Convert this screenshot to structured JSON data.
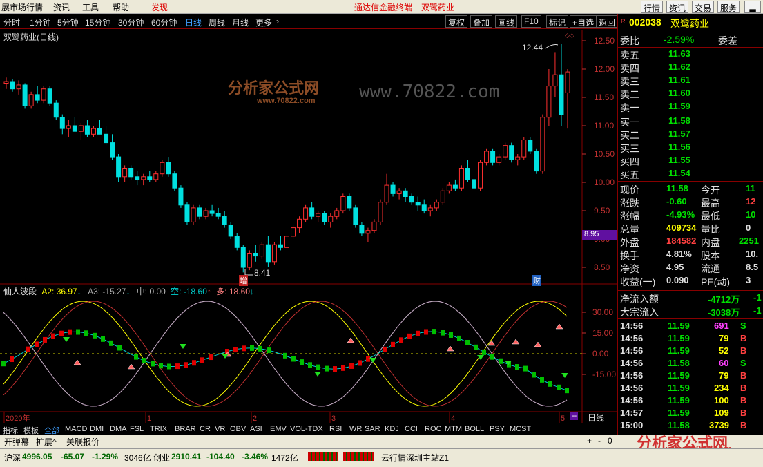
{
  "menu": {
    "items": [
      "展市场行情",
      "资讯",
      "工具",
      "帮助",
      "发现"
    ],
    "promo": [
      "通达信金融终端",
      "双鹭药业"
    ],
    "right_buttons": [
      "行情",
      "资讯",
      "交易",
      "服务"
    ]
  },
  "toolbar": {
    "periods": [
      "分时",
      "1分钟",
      "5分钟",
      "15分钟",
      "30分钟",
      "60分钟",
      "日线",
      "周线",
      "月线",
      "更多"
    ],
    "active_period": "日线",
    "actions": [
      "复权",
      "叠加",
      "画线",
      "F10",
      "标记",
      "+自选",
      "返回"
    ]
  },
  "chart_title": "双鹭药业(日线)",
  "watermark": {
    "main": "www.70822.com",
    "logo": "分析家公式网",
    "logo_sub": "www.70822.com"
  },
  "price_axis": {
    "labels": [
      "12.50",
      "12.00",
      "11.50",
      "11.00",
      "10.50",
      "10.00",
      "9.50",
      "9.00",
      "8.50"
    ],
    "highlight": "8.95"
  },
  "annotations": {
    "high": "12.44",
    "low": "8.41",
    "tag_zeng": "增",
    "tag_cai": "财"
  },
  "indicator": {
    "name": "仙人波段",
    "a2": "A2: 36.97",
    "a3": "A3: -15.27",
    "mid": "中: 0.00",
    "kong": "空: -18.60",
    "duo": "多: 18.60",
    "axis": [
      "30.00",
      "15.00",
      "0.00",
      "-15.00"
    ]
  },
  "time_axis": {
    "labels": [
      "2020年",
      "1",
      "2",
      "3",
      "4",
      "5"
    ],
    "period_label": "日线"
  },
  "tabs": [
    "指标",
    "模板",
    "全部",
    "MACD",
    "DMI",
    "DMA",
    "FSL",
    "TRIX",
    "BRAR",
    "CR",
    "VR",
    "OBV",
    "ASI",
    "EMV",
    "VOL-TDX",
    "RSI",
    "WR",
    "SAR",
    "KDJ",
    "CCI",
    "ROC",
    "MTM",
    "BOLL",
    "PSY",
    "MCST"
  ],
  "bottom_buttons": [
    "开弹幕",
    "扩展^",
    "关联报价"
  ],
  "quote": {
    "code": "002038",
    "name": "双鹭药业",
    "weibi_label": "委比",
    "weibi": "-2.59%",
    "weicha_label": "委差",
    "asks": [
      {
        "label": "卖五",
        "price": "11.63"
      },
      {
        "label": "卖四",
        "price": "11.62"
      },
      {
        "label": "卖三",
        "price": "11.61"
      },
      {
        "label": "卖二",
        "price": "11.60"
      },
      {
        "label": "卖一",
        "price": "11.59"
      }
    ],
    "bids": [
      {
        "label": "买一",
        "price": "11.58"
      },
      {
        "label": "买二",
        "price": "11.57"
      },
      {
        "label": "买三",
        "price": "11.56"
      },
      {
        "label": "买四",
        "price": "11.55"
      },
      {
        "label": "买五",
        "price": "11.54"
      }
    ],
    "stats": [
      {
        "l1": "现价",
        "v1": "11.58",
        "l2": "今开",
        "v2": "11"
      },
      {
        "l1": "涨跌",
        "v1": "-0.60",
        "l2": "最高",
        "v2": "12"
      },
      {
        "l1": "涨幅",
        "v1": "-4.93%",
        "l2": "最低",
        "v2": "10"
      },
      {
        "l1": "总量",
        "v1": "409734",
        "l2": "量比",
        "v2": "0"
      },
      {
        "l1": "外盘",
        "v1": "184582",
        "l2": "内盘",
        "v2": "2251"
      },
      {
        "l1": "换手",
        "v1": "4.81%",
        "l2": "股本",
        "v2": "10."
      },
      {
        "l1": "净资",
        "v1": "4.95",
        "l2": "流通",
        "v2": "8.5"
      },
      {
        "l1": "收益(一)",
        "v1": "0.090",
        "l2": "PE(动)",
        "v2": "3"
      }
    ],
    "flows": [
      {
        "label": "净流入额",
        "value": "-4712万",
        "extra": "-1"
      },
      {
        "label": "大宗流入",
        "value": "-3038万",
        "extra": "-1"
      }
    ],
    "ticks": [
      {
        "t": "14:56",
        "p": "11.59",
        "v": "691",
        "s": "S"
      },
      {
        "t": "14:56",
        "p": "11.59",
        "v": "79",
        "s": "B"
      },
      {
        "t": "14:56",
        "p": "11.59",
        "v": "52",
        "s": "B"
      },
      {
        "t": "14:56",
        "p": "11.58",
        "v": "60",
        "s": "S"
      },
      {
        "t": "14:56",
        "p": "11.59",
        "v": "79",
        "s": "B"
      },
      {
        "t": "14:56",
        "p": "11.59",
        "v": "234",
        "s": "B"
      },
      {
        "t": "14:56",
        "p": "11.59",
        "v": "100",
        "s": "B"
      },
      {
        "t": "14:57",
        "p": "11.59",
        "v": "109",
        "s": "B"
      },
      {
        "t": "15:00",
        "p": "11.58",
        "v": "3739",
        "s": "B"
      }
    ]
  },
  "status": {
    "sh_label": "沪深",
    "sh_value": "4996.05",
    "sh_change": "-65.07",
    "sh_pct": "-1.29%",
    "sh_amount": "3046亿",
    "cy_label": "创业",
    "cy_value": "2910.41",
    "cy_change": "-104.40",
    "cy_pct": "-3.46%",
    "cy_amount": "1472亿",
    "server": "云行情深圳主站Z1"
  },
  "candles": [
    [
      11.75,
      11.85,
      11.65,
      11.78
    ],
    [
      11.78,
      11.82,
      11.6,
      11.65
    ],
    [
      11.65,
      11.8,
      11.55,
      11.72
    ],
    [
      11.72,
      11.75,
      11.3,
      11.35
    ],
    [
      11.35,
      11.6,
      11.3,
      11.55
    ],
    [
      11.55,
      11.7,
      11.4,
      11.45
    ],
    [
      11.45,
      11.7,
      11.4,
      11.65
    ],
    [
      11.65,
      11.7,
      11.35,
      11.4
    ],
    [
      11.4,
      11.45,
      11.1,
      11.15
    ],
    [
      11.15,
      11.2,
      10.85,
      10.95
    ],
    [
      10.95,
      11.1,
      10.8,
      11.0
    ],
    [
      11.0,
      11.15,
      10.9,
      10.9
    ],
    [
      10.9,
      11.05,
      10.75,
      11.0
    ],
    [
      11.0,
      11.1,
      10.8,
      10.85
    ],
    [
      10.85,
      11.0,
      10.8,
      10.95
    ],
    [
      10.95,
      11.1,
      10.85,
      10.85
    ],
    [
      10.85,
      11.0,
      10.65,
      10.7
    ],
    [
      10.7,
      10.85,
      10.4,
      10.45
    ],
    [
      10.45,
      10.5,
      10.0,
      10.1
    ],
    [
      10.1,
      10.3,
      10.0,
      10.25
    ],
    [
      10.25,
      10.3,
      10.05,
      10.1
    ],
    [
      10.1,
      10.2,
      9.95,
      10.05
    ],
    [
      10.05,
      10.15,
      9.95,
      10.1
    ],
    [
      10.1,
      10.2,
      10.0,
      10.05
    ],
    [
      10.05,
      10.2,
      10.0,
      10.15
    ],
    [
      10.15,
      10.4,
      10.1,
      10.35
    ],
    [
      10.35,
      10.45,
      10.1,
      10.15
    ],
    [
      10.15,
      10.2,
      9.85,
      9.9
    ],
    [
      9.9,
      9.95,
      9.55,
      9.6
    ],
    [
      9.6,
      9.65,
      9.25,
      9.3
    ],
    [
      9.3,
      9.6,
      9.25,
      9.55
    ],
    [
      9.55,
      9.6,
      9.35,
      9.4
    ],
    [
      9.4,
      9.55,
      9.35,
      9.5
    ],
    [
      9.5,
      9.6,
      9.4,
      9.45
    ],
    [
      9.45,
      9.55,
      9.35,
      9.4
    ],
    [
      9.4,
      9.5,
      9.2,
      9.25
    ],
    [
      9.25,
      9.3,
      9.0,
      9.05
    ],
    [
      9.05,
      9.1,
      8.8,
      8.85
    ],
    [
      8.85,
      8.9,
      8.41,
      8.5
    ],
    [
      8.5,
      8.8,
      8.45,
      8.75
    ],
    [
      8.75,
      8.9,
      8.6,
      8.7
    ],
    [
      8.7,
      8.95,
      8.65,
      8.9
    ],
    [
      8.9,
      9.05,
      8.5,
      8.6
    ],
    [
      8.6,
      8.95,
      8.55,
      8.9
    ],
    [
      8.9,
      9.05,
      8.8,
      8.85
    ],
    [
      8.85,
      9.1,
      8.8,
      9.05
    ],
    [
      9.05,
      9.25,
      9.0,
      9.2
    ],
    [
      9.2,
      9.4,
      9.1,
      9.35
    ],
    [
      9.35,
      9.6,
      9.3,
      9.55
    ],
    [
      9.55,
      9.65,
      9.35,
      9.4
    ],
    [
      9.4,
      9.5,
      9.3,
      9.45
    ],
    [
      9.45,
      9.5,
      9.25,
      9.3
    ],
    [
      9.3,
      9.45,
      9.2,
      9.4
    ],
    [
      9.4,
      9.55,
      9.35,
      9.5
    ],
    [
      9.5,
      9.8,
      9.45,
      9.75
    ],
    [
      9.75,
      9.8,
      9.5,
      9.55
    ],
    [
      9.55,
      9.6,
      9.2,
      9.25
    ],
    [
      9.25,
      9.3,
      9.05,
      9.1
    ],
    [
      9.1,
      9.2,
      8.95,
      9.15
    ],
    [
      9.15,
      9.35,
      9.1,
      9.3
    ],
    [
      9.3,
      9.7,
      9.25,
      9.65
    ],
    [
      9.65,
      10.15,
      9.6,
      9.95
    ],
    [
      9.95,
      10.0,
      9.75,
      9.8
    ],
    [
      9.8,
      9.9,
      9.7,
      9.85
    ],
    [
      9.85,
      9.9,
      9.65,
      9.75
    ],
    [
      9.75,
      9.8,
      9.6,
      9.65
    ],
    [
      9.65,
      9.75,
      9.5,
      9.6
    ],
    [
      9.6,
      9.7,
      9.45,
      9.5
    ],
    [
      9.5,
      9.6,
      9.4,
      9.55
    ],
    [
      9.55,
      9.7,
      9.5,
      9.65
    ],
    [
      9.65,
      9.9,
      9.6,
      9.85
    ],
    [
      9.85,
      10.0,
      9.8,
      9.95
    ],
    [
      9.95,
      10.05,
      9.85,
      9.9
    ],
    [
      9.9,
      10.3,
      9.85,
      10.25
    ],
    [
      10.25,
      10.4,
      10.0,
      10.05
    ],
    [
      10.05,
      10.1,
      9.85,
      9.9
    ],
    [
      9.9,
      10.4,
      9.85,
      10.35
    ],
    [
      10.35,
      10.6,
      10.3,
      10.55
    ],
    [
      10.55,
      10.6,
      10.3,
      10.35
    ],
    [
      10.35,
      10.5,
      10.3,
      10.45
    ],
    [
      10.45,
      10.7,
      10.4,
      10.65
    ],
    [
      10.65,
      10.7,
      10.35,
      10.4
    ],
    [
      10.4,
      10.5,
      10.3,
      10.45
    ],
    [
      10.45,
      10.8,
      10.4,
      10.75
    ],
    [
      10.75,
      10.8,
      10.5,
      10.55
    ],
    [
      10.55,
      10.6,
      10.15,
      10.2
    ],
    [
      10.2,
      11.2,
      10.15,
      11.15
    ],
    [
      11.15,
      12.0,
      11.0,
      11.7
    ],
    [
      11.7,
      12.3,
      11.5,
      11.9
    ],
    [
      11.9,
      12.44,
      11.0,
      11.2
    ],
    [
      11.58,
      12.0,
      10.95,
      11.95
    ]
  ]
}
